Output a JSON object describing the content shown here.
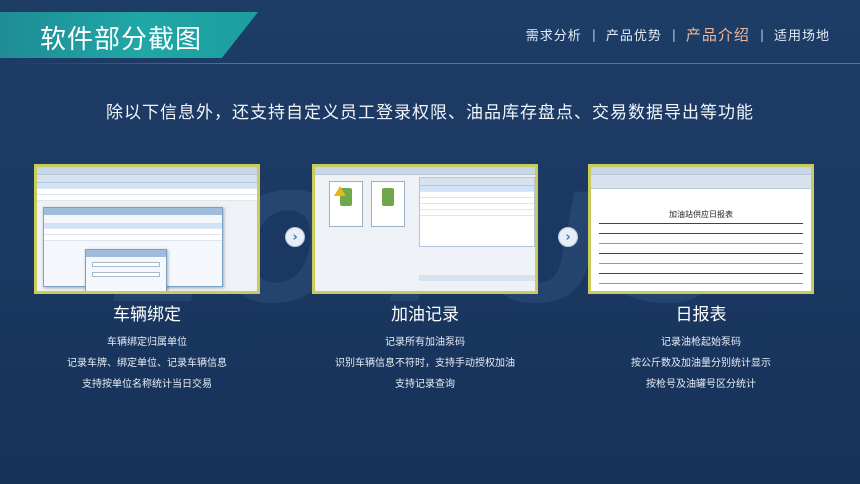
{
  "header": {
    "title": "软件部分截图",
    "nav": [
      {
        "label": "需求分析",
        "active": false
      },
      {
        "label": "产品优势",
        "active": false
      },
      {
        "label": "产品介绍",
        "active": true
      },
      {
        "label": "适用场地",
        "active": false
      }
    ],
    "separator": "|"
  },
  "subtitle": "除以下信息外，还支持自定义员工登录权限、油品库存盘点、交易数据导出等功能",
  "watermark": "LOTUS",
  "arrow_glyph": "›",
  "sections": [
    {
      "title": "车辆绑定",
      "features": [
        "车辆绑定归属单位",
        "记录车牌、绑定单位、记录车辆信息",
        "支持按单位名称统计当日交易"
      ]
    },
    {
      "title": "加油记录",
      "features": [
        "记录所有加油泵码",
        "识别车辆信息不符时，支持手动授权加油",
        "支持记录查询"
      ]
    },
    {
      "title": "日报表",
      "features": [
        "记录油枪起始泵码",
        "按公斤数及加油量分别统计显示",
        "按枪号及油罐号区分统计"
      ]
    }
  ],
  "screens": {
    "report": {
      "title": "加油站供应日报表"
    }
  },
  "colors": {
    "accent_teal": "#20a7a6",
    "nav_active": "#f0b89a",
    "frame": "#c9cc5a",
    "background": "#1a3862"
  }
}
